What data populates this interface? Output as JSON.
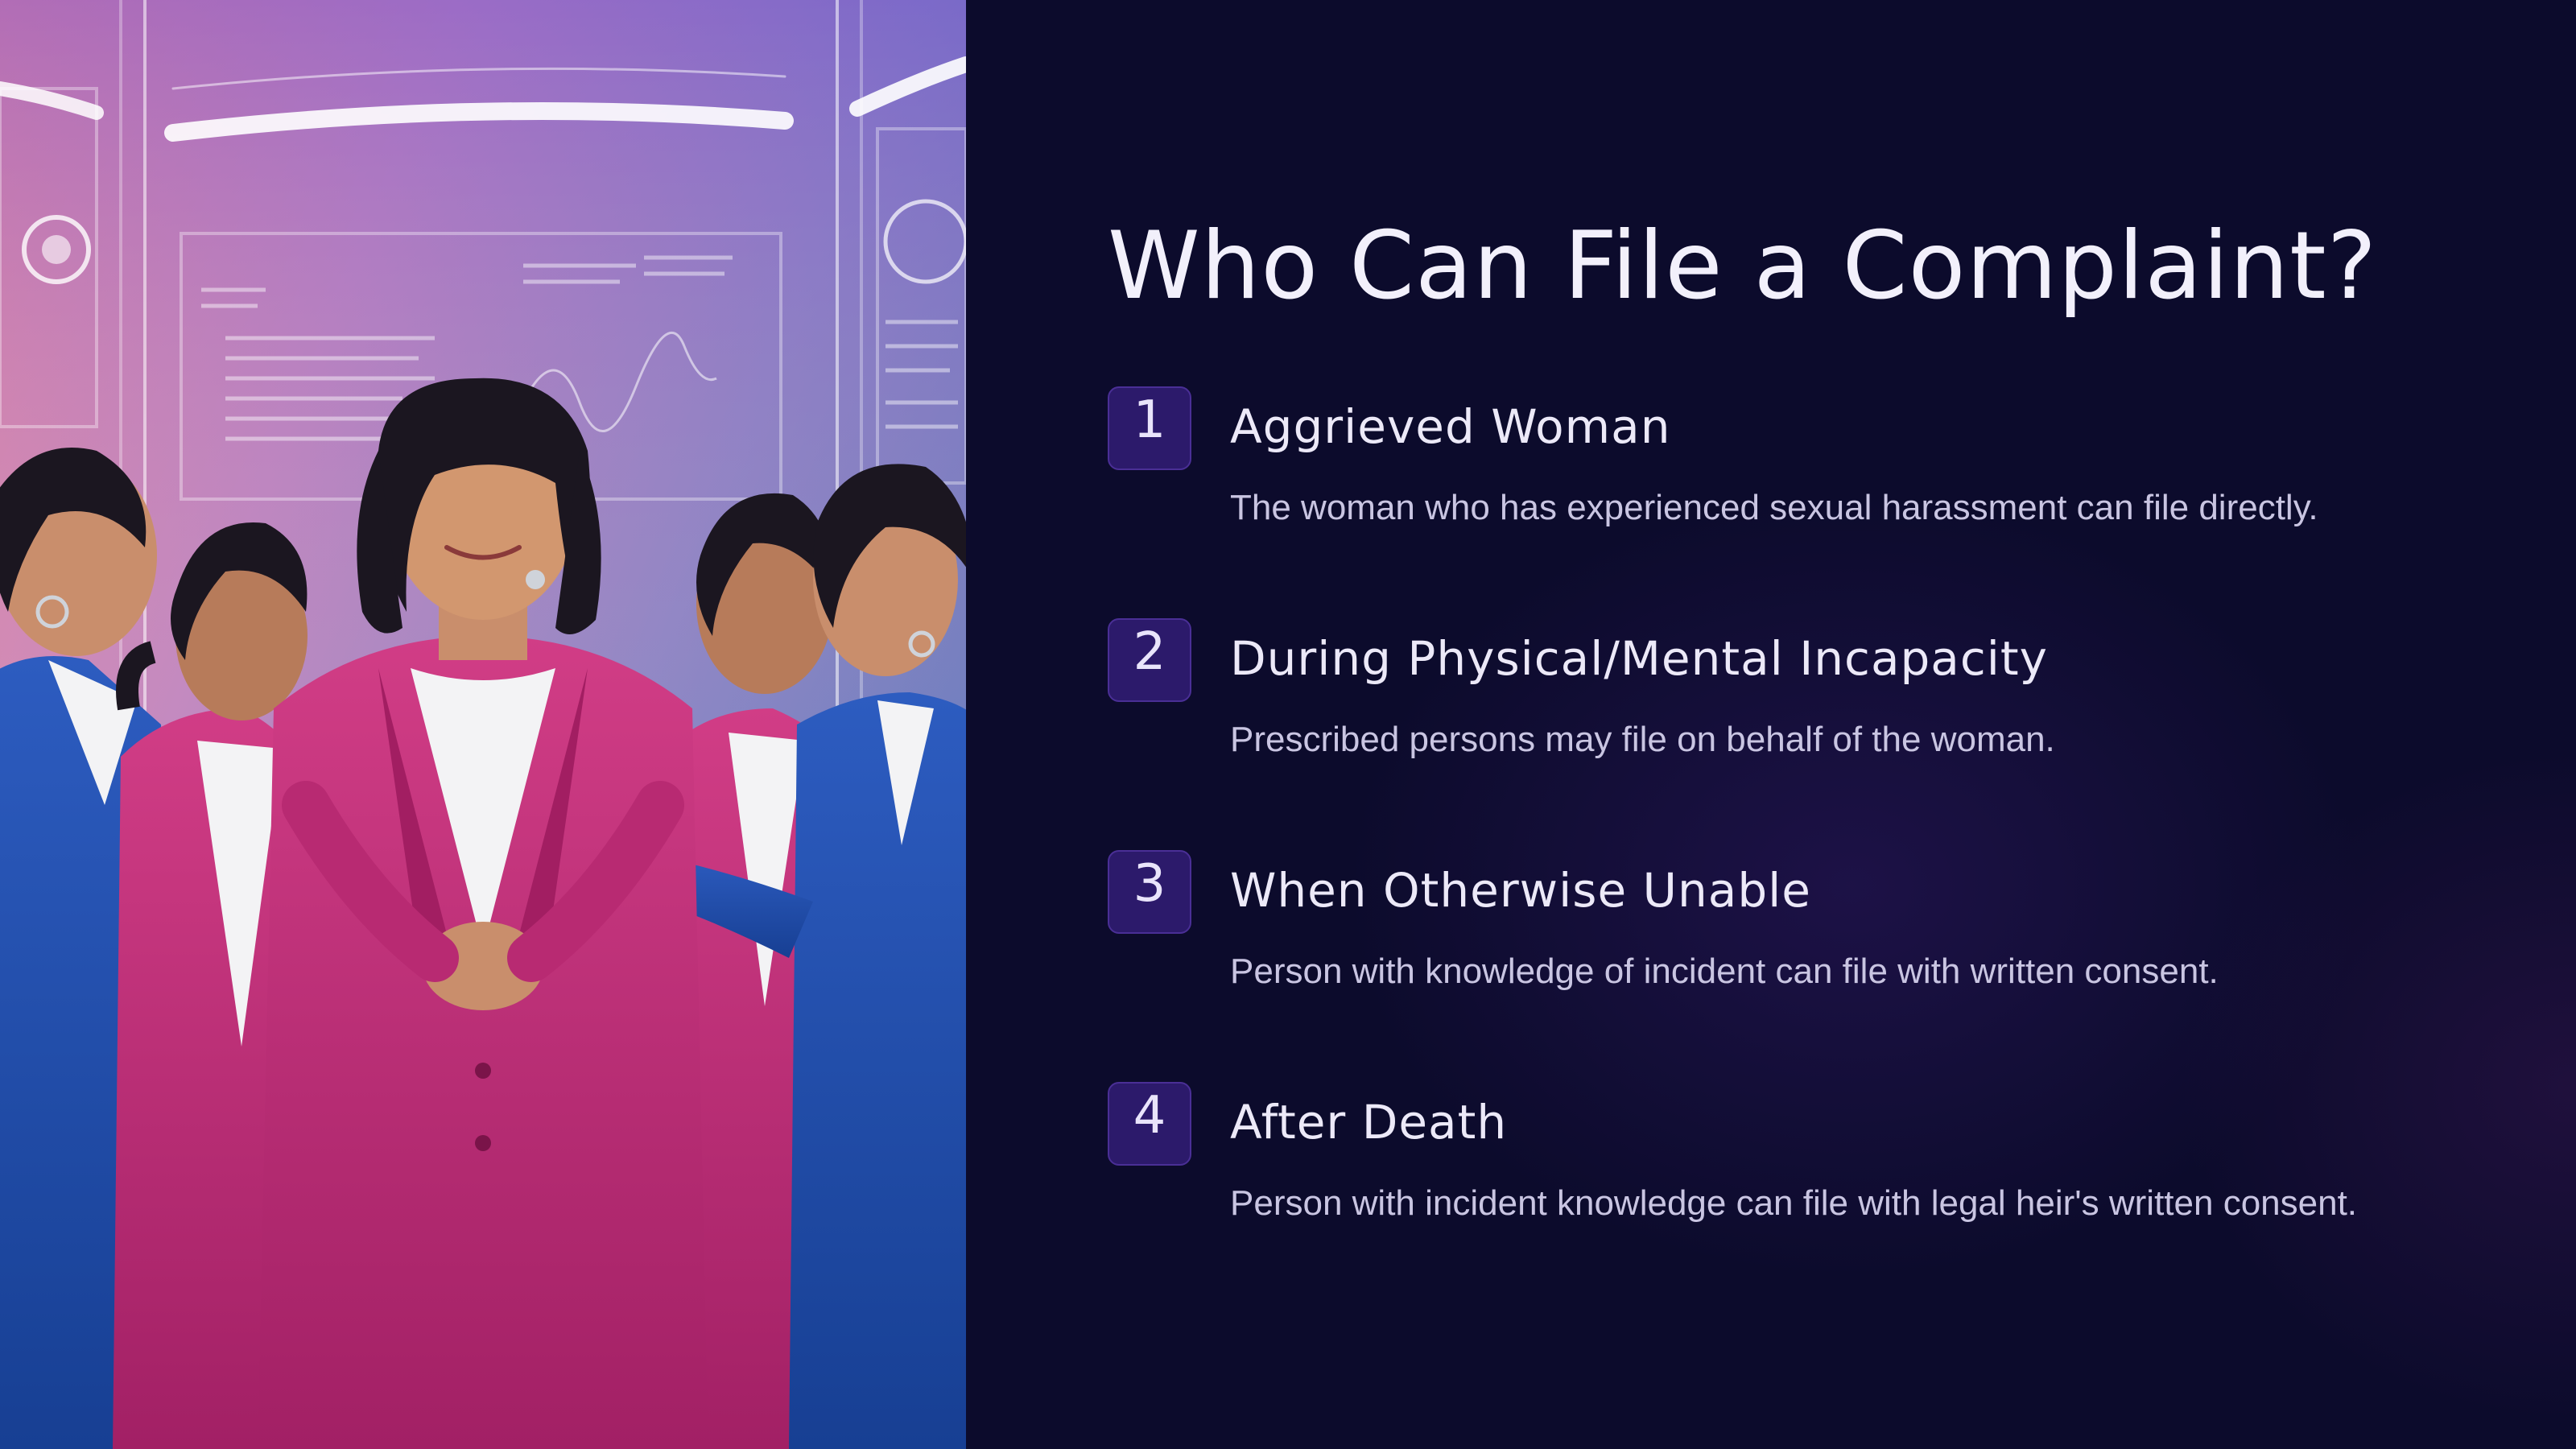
{
  "slide": {
    "title": "Who Can File a Complaint?",
    "image": {
      "description_icon": "illustration-women-colleagues",
      "colors": {
        "background_top": "#7a5fc0",
        "background_pink": "#e98aa6",
        "background_blue": "#3d6fc4",
        "pink_suit": "#c2307a",
        "blue_suit": "#1f4ea8"
      }
    },
    "items": [
      {
        "number": "1",
        "title": "Aggrieved Woman",
        "description": "The woman who has experienced sexual harassment can file directly."
      },
      {
        "number": "2",
        "title": "During Physical/Mental Incapacity",
        "description": "Prescribed persons may file on behalf of the woman."
      },
      {
        "number": "3",
        "title": "When Otherwise Unable",
        "description": "Person with knowledge of incident can file with written consent."
      },
      {
        "number": "4",
        "title": "After Death",
        "description": "Person with incident knowledge can file with legal heir's written consent."
      }
    ],
    "colors": {
      "background": "#0c0b2c",
      "badge_fill": "#2c1a6b",
      "badge_border": "#4a2f96",
      "title_text": "#f2f0fb",
      "body_text": "#c9c5e2"
    }
  }
}
